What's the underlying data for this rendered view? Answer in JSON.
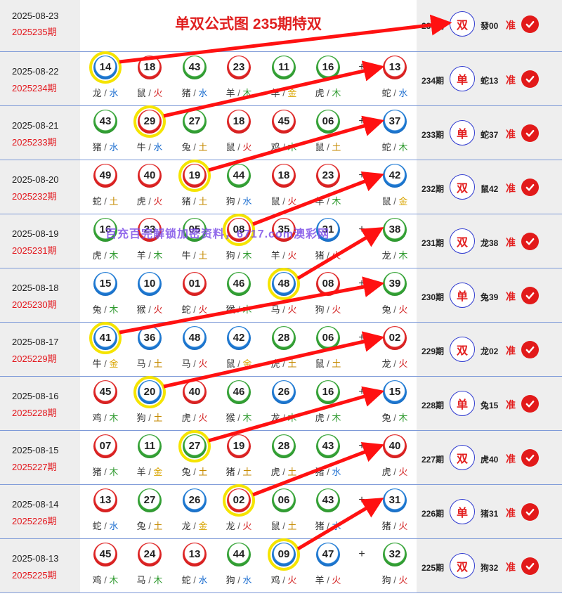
{
  "title": "单双公式图 235期特双",
  "watermark": "百充百完解锁加密资料，6717.com澳彩网",
  "colors": {
    "red_ball": "#e02626",
    "blue_ball": "#1f7cd6",
    "green_ball": "#36a537",
    "highlight_ring": "#f5e400",
    "arrow": "#ff1111",
    "accent_text": "#e3161c"
  },
  "header_row": {
    "date": "2025-08-23",
    "issue": "2025235期",
    "result": {
      "period": "235期",
      "type": "双",
      "pick": "發00",
      "verdict": "准",
      "verdict_icon": "check-icon"
    }
  },
  "rows": [
    {
      "date": "2025-08-22",
      "issue": "2025234期",
      "highlight": 0,
      "balls": [
        {
          "num": "14",
          "color": "blue",
          "zodiac": "龙",
          "element": "水"
        },
        {
          "num": "18",
          "color": "red",
          "zodiac": "鼠",
          "element": "火"
        },
        {
          "num": "43",
          "color": "green",
          "zodiac": "猪",
          "element": "水"
        },
        {
          "num": "23",
          "color": "red",
          "zodiac": "羊",
          "element": "木"
        },
        {
          "num": "11",
          "color": "green",
          "zodiac": "羊",
          "element": "金"
        },
        {
          "num": "16",
          "color": "green",
          "zodiac": "虎",
          "element": "木"
        },
        {
          "num": "13",
          "color": "red",
          "zodiac": "蛇",
          "element": "水"
        }
      ],
      "result": {
        "period": "234期",
        "type": "单",
        "pick": "蛇13",
        "verdict": "准"
      }
    },
    {
      "date": "2025-08-21",
      "issue": "2025233期",
      "highlight": 1,
      "balls": [
        {
          "num": "43",
          "color": "green",
          "zodiac": "猪",
          "element": "水"
        },
        {
          "num": "29",
          "color": "red",
          "zodiac": "牛",
          "element": "水"
        },
        {
          "num": "27",
          "color": "green",
          "zodiac": "兔",
          "element": "土"
        },
        {
          "num": "18",
          "color": "red",
          "zodiac": "鼠",
          "element": "火"
        },
        {
          "num": "45",
          "color": "red",
          "zodiac": "鸡",
          "element": "木"
        },
        {
          "num": "06",
          "color": "green",
          "zodiac": "鼠",
          "element": "土"
        },
        {
          "num": "37",
          "color": "blue",
          "zodiac": "蛇",
          "element": "木"
        }
      ],
      "result": {
        "period": "233期",
        "type": "单",
        "pick": "蛇37",
        "verdict": "准"
      }
    },
    {
      "date": "2025-08-20",
      "issue": "2025232期",
      "highlight": 2,
      "balls": [
        {
          "num": "49",
          "color": "red",
          "zodiac": "蛇",
          "element": "土"
        },
        {
          "num": "40",
          "color": "red",
          "zodiac": "虎",
          "element": "火"
        },
        {
          "num": "19",
          "color": "red",
          "zodiac": "猪",
          "element": "土"
        },
        {
          "num": "44",
          "color": "green",
          "zodiac": "狗",
          "element": "水"
        },
        {
          "num": "18",
          "color": "red",
          "zodiac": "鼠",
          "element": "火"
        },
        {
          "num": "23",
          "color": "red",
          "zodiac": "羊",
          "element": "木"
        },
        {
          "num": "42",
          "color": "blue",
          "zodiac": "鼠",
          "element": "金"
        }
      ],
      "result": {
        "period": "232期",
        "type": "双",
        "pick": "鼠42",
        "verdict": "准"
      }
    },
    {
      "date": "2025-08-19",
      "issue": "2025231期",
      "highlight": 3,
      "balls": [
        {
          "num": "16",
          "color": "green",
          "zodiac": "虎",
          "element": "木"
        },
        {
          "num": "23",
          "color": "red",
          "zodiac": "羊",
          "element": "木"
        },
        {
          "num": "05",
          "color": "green",
          "zodiac": "牛",
          "element": "土"
        },
        {
          "num": "08",
          "color": "red",
          "zodiac": "狗",
          "element": "木"
        },
        {
          "num": "35",
          "color": "red",
          "zodiac": "羊",
          "element": "火"
        },
        {
          "num": "31",
          "color": "blue",
          "zodiac": "猪",
          "element": "火"
        },
        {
          "num": "38",
          "color": "green",
          "zodiac": "龙",
          "element": "木"
        }
      ],
      "result": {
        "period": "231期",
        "type": "双",
        "pick": "龙38",
        "verdict": "准"
      }
    },
    {
      "date": "2025-08-18",
      "issue": "2025230期",
      "highlight": 4,
      "balls": [
        {
          "num": "15",
          "color": "blue",
          "zodiac": "兔",
          "element": "木"
        },
        {
          "num": "10",
          "color": "blue",
          "zodiac": "猴",
          "element": "火"
        },
        {
          "num": "01",
          "color": "red",
          "zodiac": "蛇",
          "element": "火"
        },
        {
          "num": "46",
          "color": "green",
          "zodiac": "猴",
          "element": "木"
        },
        {
          "num": "48",
          "color": "blue",
          "zodiac": "马",
          "element": "火"
        },
        {
          "num": "08",
          "color": "red",
          "zodiac": "狗",
          "element": "火"
        },
        {
          "num": "39",
          "color": "green",
          "zodiac": "兔",
          "element": "火"
        }
      ],
      "result": {
        "period": "230期",
        "type": "单",
        "pick": "兔39",
        "verdict": "准"
      }
    },
    {
      "date": "2025-08-17",
      "issue": "2025229期",
      "highlight": 0,
      "balls": [
        {
          "num": "41",
          "color": "blue",
          "zodiac": "牛",
          "element": "金"
        },
        {
          "num": "36",
          "color": "blue",
          "zodiac": "马",
          "element": "土"
        },
        {
          "num": "48",
          "color": "blue",
          "zodiac": "马",
          "element": "火"
        },
        {
          "num": "42",
          "color": "blue",
          "zodiac": "鼠",
          "element": "金"
        },
        {
          "num": "28",
          "color": "green",
          "zodiac": "虎",
          "element": "土"
        },
        {
          "num": "06",
          "color": "green",
          "zodiac": "鼠",
          "element": "土"
        },
        {
          "num": "02",
          "color": "red",
          "zodiac": "龙",
          "element": "火"
        }
      ],
      "result": {
        "period": "229期",
        "type": "双",
        "pick": "龙02",
        "verdict": "准"
      }
    },
    {
      "date": "2025-08-16",
      "issue": "2025228期",
      "highlight": 1,
      "balls": [
        {
          "num": "45",
          "color": "red",
          "zodiac": "鸡",
          "element": "木"
        },
        {
          "num": "20",
          "color": "blue",
          "zodiac": "狗",
          "element": "土"
        },
        {
          "num": "40",
          "color": "red",
          "zodiac": "虎",
          "element": "火"
        },
        {
          "num": "46",
          "color": "green",
          "zodiac": "猴",
          "element": "木"
        },
        {
          "num": "26",
          "color": "blue",
          "zodiac": "龙",
          "element": "木"
        },
        {
          "num": "16",
          "color": "green",
          "zodiac": "虎",
          "element": "木"
        },
        {
          "num": "15",
          "color": "blue",
          "zodiac": "兔",
          "element": "木"
        }
      ],
      "result": {
        "period": "228期",
        "type": "单",
        "pick": "兔15",
        "verdict": "准"
      }
    },
    {
      "date": "2025-08-15",
      "issue": "2025227期",
      "highlight": 2,
      "balls": [
        {
          "num": "07",
          "color": "red",
          "zodiac": "猪",
          "element": "木"
        },
        {
          "num": "11",
          "color": "green",
          "zodiac": "羊",
          "element": "金"
        },
        {
          "num": "27",
          "color": "green",
          "zodiac": "兔",
          "element": "土"
        },
        {
          "num": "19",
          "color": "red",
          "zodiac": "猪",
          "element": "土"
        },
        {
          "num": "28",
          "color": "green",
          "zodiac": "虎",
          "element": "土"
        },
        {
          "num": "43",
          "color": "green",
          "zodiac": "猪",
          "element": "水"
        },
        {
          "num": "40",
          "color": "red",
          "zodiac": "虎",
          "element": "火"
        }
      ],
      "result": {
        "period": "227期",
        "type": "双",
        "pick": "虎40",
        "verdict": "准"
      }
    },
    {
      "date": "2025-08-14",
      "issue": "2025226期",
      "highlight": 3,
      "balls": [
        {
          "num": "13",
          "color": "red",
          "zodiac": "蛇",
          "element": "水"
        },
        {
          "num": "27",
          "color": "green",
          "zodiac": "兔",
          "element": "土"
        },
        {
          "num": "26",
          "color": "blue",
          "zodiac": "龙",
          "element": "金"
        },
        {
          "num": "02",
          "color": "red",
          "zodiac": "龙",
          "element": "火"
        },
        {
          "num": "06",
          "color": "green",
          "zodiac": "鼠",
          "element": "土"
        },
        {
          "num": "43",
          "color": "green",
          "zodiac": "猪",
          "element": "水"
        },
        {
          "num": "31",
          "color": "blue",
          "zodiac": "猪",
          "element": "火"
        }
      ],
      "result": {
        "period": "226期",
        "type": "单",
        "pick": "猪31",
        "verdict": "准"
      }
    },
    {
      "date": "2025-08-13",
      "issue": "2025225期",
      "highlight": 4,
      "balls": [
        {
          "num": "45",
          "color": "red",
          "zodiac": "鸡",
          "element": "木"
        },
        {
          "num": "24",
          "color": "red",
          "zodiac": "马",
          "element": "木"
        },
        {
          "num": "13",
          "color": "red",
          "zodiac": "蛇",
          "element": "水"
        },
        {
          "num": "44",
          "color": "green",
          "zodiac": "狗",
          "element": "水"
        },
        {
          "num": "09",
          "color": "blue",
          "zodiac": "鸡",
          "element": "火"
        },
        {
          "num": "47",
          "color": "blue",
          "zodiac": "羊",
          "element": "火"
        },
        {
          "num": "32",
          "color": "green",
          "zodiac": "狗",
          "element": "火"
        }
      ],
      "result": {
        "period": "225期",
        "type": "双",
        "pick": "狗32",
        "verdict": "准"
      }
    }
  ]
}
